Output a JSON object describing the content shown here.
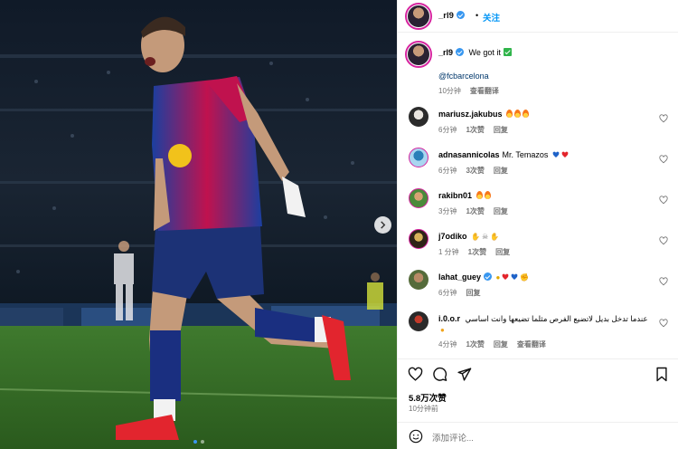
{
  "header": {
    "username": "_rl9",
    "separator": "•",
    "follow_label": "关注"
  },
  "caption": {
    "username": "_rl9",
    "text": "We got it",
    "mention": "@fcbarcelona",
    "time": "10分钟",
    "translate": "查看翻译"
  },
  "comments": [
    {
      "username": "mariusz.jakubus",
      "text": "",
      "time": "6分钟",
      "likes": "1次赞",
      "reply": "回复",
      "translate": ""
    },
    {
      "username": "adnasannicolas",
      "text": "Mr. Temazos",
      "time": "6分钟",
      "likes": "3次赞",
      "reply": "回复",
      "translate": ""
    },
    {
      "username": "rakibn01",
      "text": "",
      "time": "3分钟",
      "likes": "1次赞",
      "reply": "回复",
      "translate": ""
    },
    {
      "username": "j7odiko",
      "text": "",
      "time": "1 分钟",
      "likes": "1次赞",
      "reply": "回复",
      "translate": ""
    },
    {
      "username": "lahat_guey",
      "text": "",
      "time": "6分钟",
      "likes": "",
      "reply": "回复",
      "translate": ""
    },
    {
      "username": "i.0.o.r",
      "text": "عندما تدخل بديل لاتضيع الفرص مثلما تضيعها وانت اساسي",
      "time": "4分钟",
      "likes": "1次赞",
      "reply": "回复",
      "translate": "查看翻译"
    }
  ],
  "stats": {
    "likes": "5.8万次赞",
    "time_ago": "10分钟前"
  },
  "comment_input": {
    "placeholder": "添加评论..."
  },
  "colors": {
    "accent": "#0095f6",
    "verified": "#3897f0",
    "meta_text": "#737373",
    "border": "#efefef"
  },
  "icons": [
    "heart-icon",
    "comment-icon",
    "share-icon",
    "bookmark-icon",
    "smile-icon",
    "verified-icon",
    "chevron-right-icon"
  ]
}
